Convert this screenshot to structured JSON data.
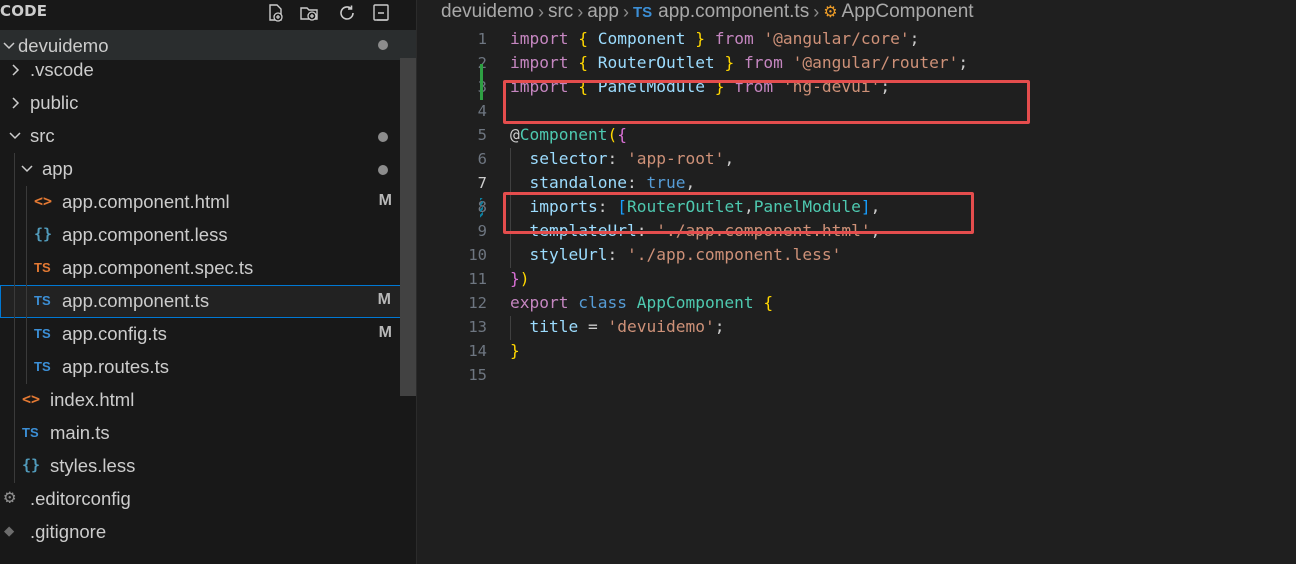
{
  "sidebar": {
    "title": "CODE",
    "actions": [
      {
        "name": "new-file-icon"
      },
      {
        "name": "new-folder-icon"
      },
      {
        "name": "refresh-icon"
      },
      {
        "name": "collapse-all-icon"
      }
    ],
    "root": {
      "label": "devuidemo",
      "modified_dot": true
    },
    "items": [
      {
        "label": ".vscode",
        "kind": "folder",
        "expanded": false,
        "depth": 0
      },
      {
        "label": "public",
        "kind": "folder",
        "expanded": false,
        "depth": 0
      },
      {
        "label": "src",
        "kind": "folder",
        "expanded": true,
        "depth": 0,
        "dot": true
      },
      {
        "label": "app",
        "kind": "folder",
        "expanded": true,
        "depth": 1,
        "dot": true
      },
      {
        "label": "app.component.html",
        "kind": "html",
        "icon": "<>",
        "depth": 2,
        "badge": "M"
      },
      {
        "label": "app.component.less",
        "kind": "less",
        "icon": "{}",
        "depth": 2
      },
      {
        "label": "app.component.spec.ts",
        "kind": "ts-spec",
        "icon": "TS",
        "depth": 2
      },
      {
        "label": "app.component.ts",
        "kind": "ts",
        "icon": "TS",
        "depth": 2,
        "badge": "M",
        "selected": true
      },
      {
        "label": "app.config.ts",
        "kind": "ts",
        "icon": "TS",
        "depth": 2,
        "badge": "M"
      },
      {
        "label": "app.routes.ts",
        "kind": "ts",
        "icon": "TS",
        "depth": 2
      },
      {
        "label": "index.html",
        "kind": "html",
        "icon": "<>",
        "depth": 1
      },
      {
        "label": "main.ts",
        "kind": "ts",
        "icon": "TS",
        "depth": 1
      },
      {
        "label": "styles.less",
        "kind": "less",
        "icon": "{}",
        "depth": 1
      },
      {
        "label": ".editorconfig",
        "kind": "gear",
        "icon": "⚙",
        "depth": 0
      },
      {
        "label": ".gitignore",
        "kind": "git",
        "icon": "◆",
        "depth": 0
      }
    ]
  },
  "breadcrumb": {
    "parts": [
      "devuidemo",
      "src",
      "app",
      "app.component.ts",
      "AppComponent"
    ],
    "ts_icon": "TS"
  },
  "editor": {
    "line_numbers": [
      "1",
      "2",
      "3",
      "4",
      "5",
      "6",
      "7",
      "8",
      "9",
      "10",
      "11",
      "12",
      "13",
      "14",
      "15"
    ],
    "active_line": "7",
    "lines": [
      {
        "n": "1",
        "tokens": [
          [
            "k",
            "import"
          ],
          [
            "d",
            " "
          ],
          [
            "b1",
            "{"
          ],
          [
            "d",
            " "
          ],
          [
            "v",
            "Component"
          ],
          [
            "d",
            " "
          ],
          [
            "b1",
            "}"
          ],
          [
            "d",
            " "
          ],
          [
            "k",
            "from"
          ],
          [
            "d",
            " "
          ],
          [
            "s",
            "'@angular/core'"
          ],
          [
            "d",
            ";"
          ]
        ]
      },
      {
        "n": "2",
        "tokens": [
          [
            "k",
            "import"
          ],
          [
            "d",
            " "
          ],
          [
            "b1",
            "{"
          ],
          [
            "d",
            " "
          ],
          [
            "v",
            "RouterOutlet"
          ],
          [
            "d",
            " "
          ],
          [
            "b1",
            "}"
          ],
          [
            "d",
            " "
          ],
          [
            "k",
            "from"
          ],
          [
            "d",
            " "
          ],
          [
            "s",
            "'@angular/router'"
          ],
          [
            "d",
            ";"
          ]
        ]
      },
      {
        "n": "3",
        "tokens": [
          [
            "k",
            "import"
          ],
          [
            "d",
            " "
          ],
          [
            "b1",
            "{"
          ],
          [
            "d",
            " "
          ],
          [
            "v",
            "PanelModule"
          ],
          [
            "d",
            " "
          ],
          [
            "b1",
            "}"
          ],
          [
            "d",
            " "
          ],
          [
            "k",
            "from"
          ],
          [
            "d",
            " "
          ],
          [
            "s",
            "'ng-devui'"
          ],
          [
            "d",
            ";"
          ]
        ]
      },
      {
        "n": "4",
        "tokens": []
      },
      {
        "n": "5",
        "tokens": [
          [
            "d",
            "@"
          ],
          [
            "t",
            "Component"
          ],
          [
            "b1",
            "("
          ],
          [
            "b2",
            "{"
          ]
        ]
      },
      {
        "n": "6",
        "tokens": [
          [
            "d",
            "  "
          ],
          [
            "v",
            "selector"
          ],
          [
            "d",
            ": "
          ],
          [
            "s",
            "'app-root'"
          ],
          [
            "d",
            ","
          ]
        ]
      },
      {
        "n": "7",
        "tokens": [
          [
            "d",
            "  "
          ],
          [
            "v",
            "standalone"
          ],
          [
            "d",
            ": "
          ],
          [
            "k2",
            "true"
          ],
          [
            "d",
            ","
          ]
        ]
      },
      {
        "n": "8",
        "tokens": [
          [
            "d",
            "  "
          ],
          [
            "v",
            "imports"
          ],
          [
            "d",
            ": "
          ],
          [
            "b3",
            "["
          ],
          [
            "t",
            "RouterOutlet"
          ],
          [
            "d",
            ","
          ],
          [
            "t",
            "PanelModule"
          ],
          [
            "b3",
            "]"
          ],
          [
            "d",
            ","
          ]
        ]
      },
      {
        "n": "9",
        "tokens": [
          [
            "d",
            "  "
          ],
          [
            "v",
            "templateUrl"
          ],
          [
            "d",
            ": "
          ],
          [
            "s",
            "'./app.component.html'"
          ],
          [
            "d",
            ","
          ]
        ]
      },
      {
        "n": "10",
        "tokens": [
          [
            "d",
            "  "
          ],
          [
            "v",
            "styleUrl"
          ],
          [
            "d",
            ": "
          ],
          [
            "s",
            "'./app.component.less'"
          ]
        ]
      },
      {
        "n": "11",
        "tokens": [
          [
            "b2",
            "}"
          ],
          [
            "b1",
            ")"
          ]
        ]
      },
      {
        "n": "12",
        "tokens": [
          [
            "k",
            "export"
          ],
          [
            "d",
            " "
          ],
          [
            "k2",
            "class"
          ],
          [
            "d",
            " "
          ],
          [
            "t",
            "AppComponent"
          ],
          [
            "d",
            " "
          ],
          [
            "b1",
            "{"
          ]
        ]
      },
      {
        "n": "13",
        "tokens": [
          [
            "d",
            "  "
          ],
          [
            "v",
            "title"
          ],
          [
            "d",
            " = "
          ],
          [
            "s",
            "'devuidemo'"
          ],
          [
            "d",
            ";"
          ]
        ]
      },
      {
        "n": "14",
        "tokens": [
          [
            "b1",
            "}"
          ]
        ]
      },
      {
        "n": "15",
        "tokens": []
      }
    ]
  },
  "colors": {
    "annotation_box": "#e44d4d",
    "added_line_marker": "#2ea043",
    "modified_line_marker": "#0c7d9d",
    "selection_outline": "#0078d4"
  }
}
